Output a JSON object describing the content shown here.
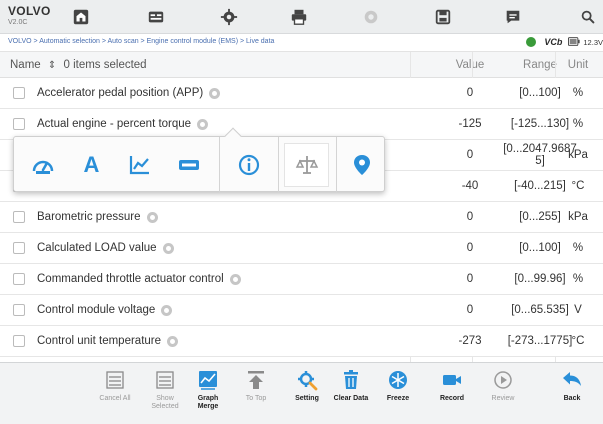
{
  "brand": {
    "name": "VOLVO",
    "version": "V2.0C"
  },
  "breadcrumb": "VOLVO > Automatic selection > Auto scan > Engine control module (EMS) > Live data",
  "status": {
    "vci": "VCb",
    "battery": "12.3V"
  },
  "table": {
    "header": {
      "name": "Name",
      "selected": "0 items selected",
      "sort": "⇕",
      "value": "Value",
      "range": "Range",
      "unit": "Unit"
    },
    "rows": [
      {
        "name": "Accelerator pedal position (APP)",
        "value": "0",
        "range": "[0...100]",
        "unit": "%"
      },
      {
        "name": "Actual engine - percent torque",
        "value": "-125",
        "range": "[-125...130]",
        "unit": "%"
      },
      {
        "name": "",
        "value": "0",
        "range_l1": "[0...2047.9687",
        "range_l2": "5]",
        "unit": "kPa"
      },
      {
        "name": "",
        "value": "-40",
        "range": "[-40...215]",
        "unit": "°C"
      },
      {
        "name": "Barometric pressure",
        "value": "0",
        "range": "[0...255]",
        "unit": "kPa"
      },
      {
        "name": "Calculated LOAD value",
        "value": "0",
        "range": "[0...100]",
        "unit": "%"
      },
      {
        "name": "Commanded throttle actuator control",
        "value": "0",
        "range": "[0...99.96]",
        "unit": "%"
      },
      {
        "name": "Control module voltage",
        "value": "0",
        "range": "[0...65.535]",
        "unit": "V"
      },
      {
        "name": "Control unit temperature",
        "value": "-273",
        "range": "[-273...1775]",
        "unit": "°C"
      }
    ]
  },
  "popup": {
    "buttons": [
      {
        "icon": "gauge-icon"
      },
      {
        "icon": "text-icon",
        "glyph": "A"
      },
      {
        "icon": "line-graph-icon"
      },
      {
        "icon": "bar-icon"
      },
      {
        "icon": "info-icon"
      },
      {
        "icon": "compare-icon"
      },
      {
        "icon": "location-pin-icon"
      }
    ]
  },
  "toolbar": {
    "cancel_all": "Cancel All",
    "show_selected_1": "Show",
    "show_selected_2": "Selected",
    "graph_merge_1": "Graph",
    "graph_merge_2": "Merge",
    "to_top": "To Top",
    "setting": "Setting",
    "clear_data": "Clear Data",
    "freeze": "Freeze",
    "record": "Record",
    "review": "Review",
    "back": "Back"
  },
  "colors": {
    "accent": "#2a8fd8",
    "brand_green": "#3a9b3a",
    "header_bg": "#eceeef"
  }
}
